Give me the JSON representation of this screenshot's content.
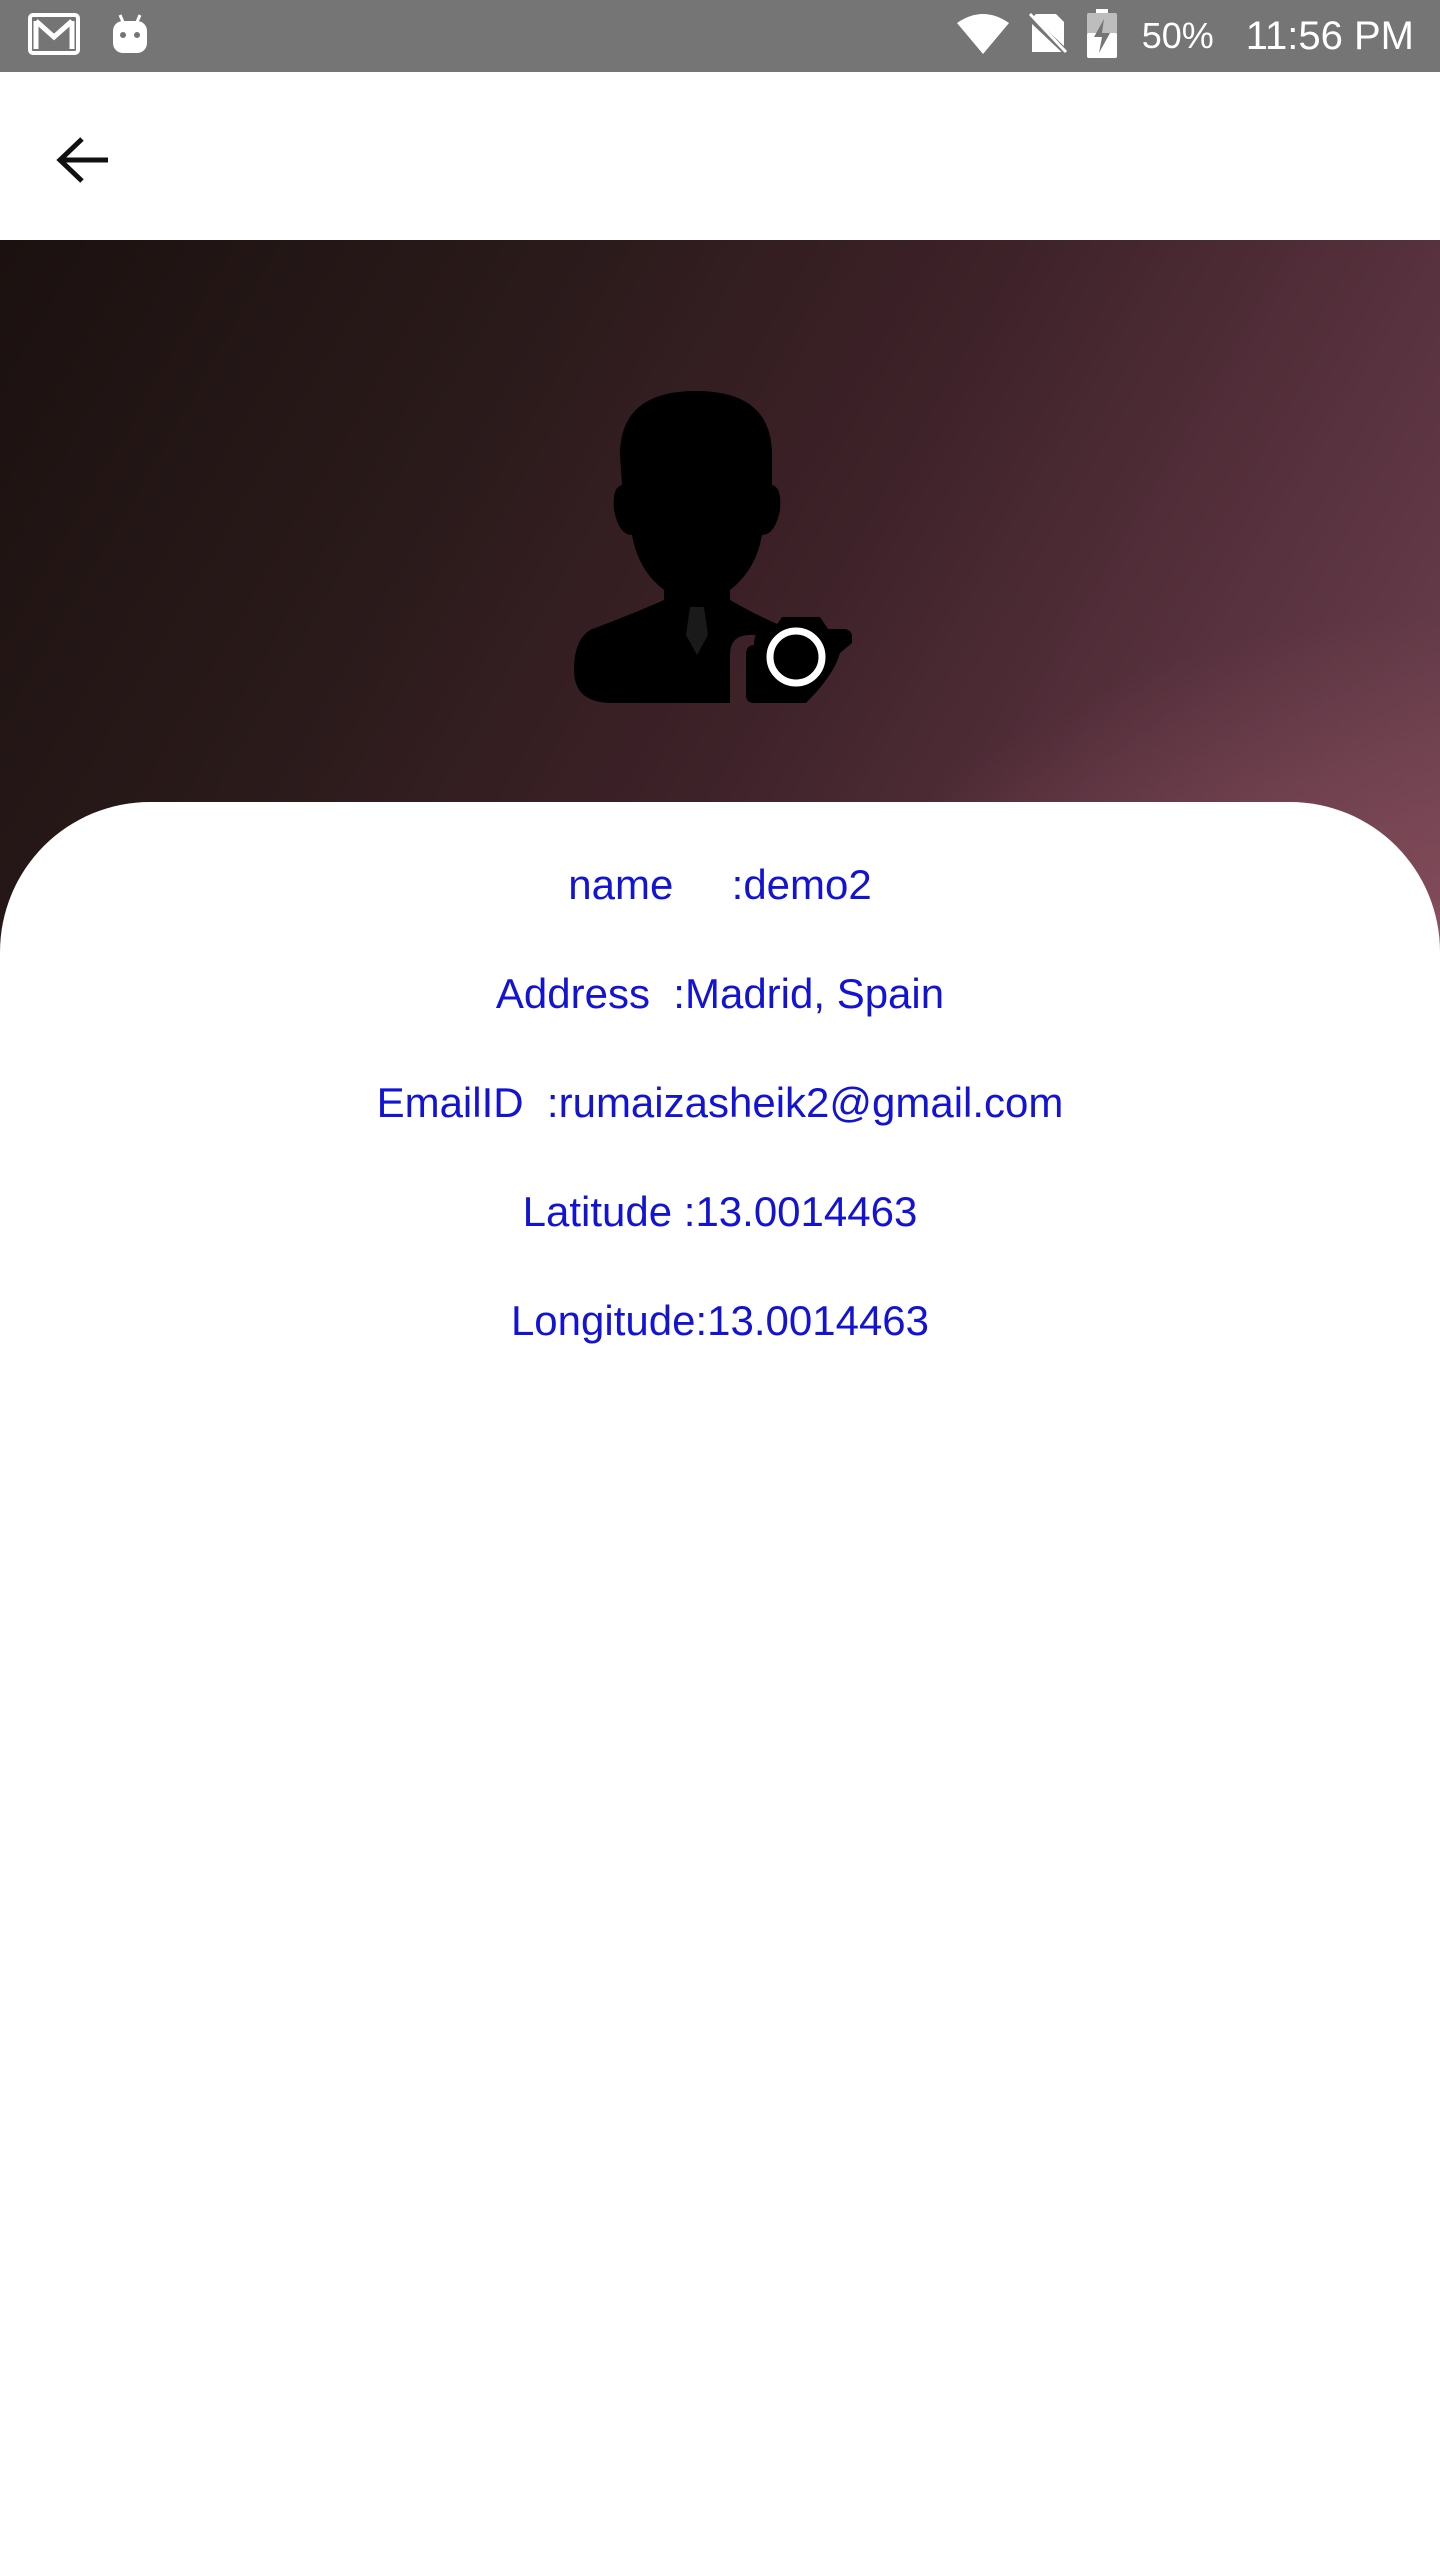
{
  "status_bar": {
    "battery_percent": "50%",
    "time": "11:56 PM",
    "icons": [
      "gmail-icon",
      "android-debug-icon",
      "wifi-icon",
      "no-sim-icon",
      "battery-charging-icon"
    ]
  },
  "app_bar": {
    "back_icon": "arrow-back-icon"
  },
  "profile": {
    "avatar_icon": "user-camera-icon",
    "name_row": "name     :demo2",
    "address_row": "Address  :Madrid, Spain",
    "email_row": "EmailID  :rumaizasheik2@gmail.com",
    "latitude_row": "Latitude :13.0014463",
    "longitude_row": "Longitude:13.0014463"
  },
  "colors": {
    "status_bar": "#757575",
    "info_text": "#1313d6",
    "header_dark": "#1b1110",
    "header_light": "#9a7074"
  }
}
